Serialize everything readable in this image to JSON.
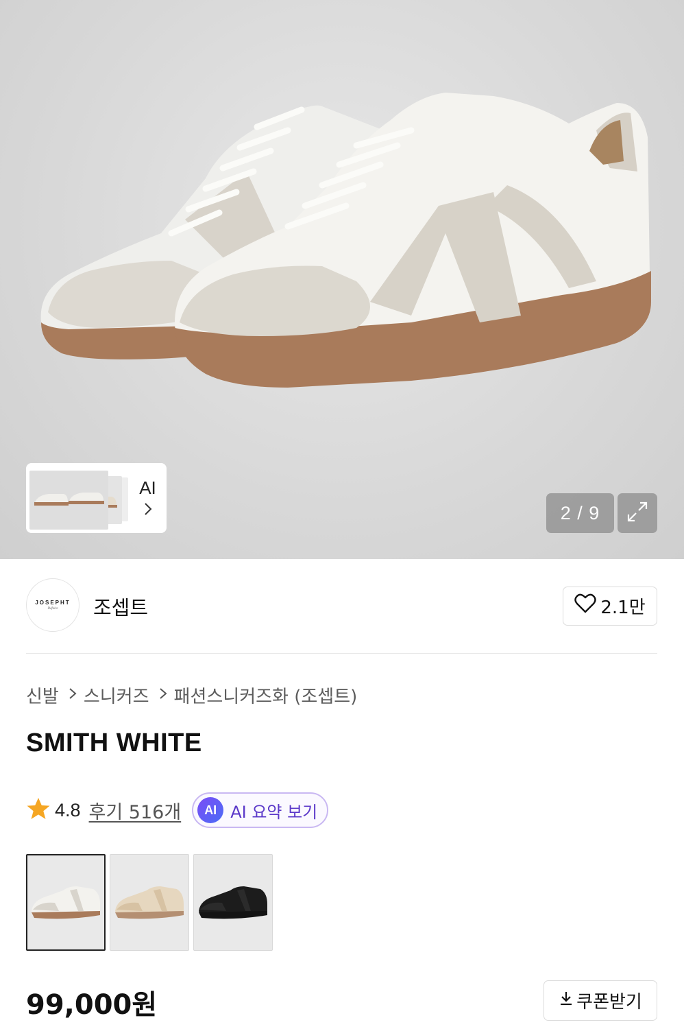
{
  "gallery": {
    "counter": "2 / 9",
    "ai_label": "AI",
    "thumb_icon": "chevron-right-icon",
    "expand_icon": "expand-icon"
  },
  "brand": {
    "logo_text": "JOSEPHT",
    "logo_sub": "Défaire",
    "name": "조셉트",
    "like_count": "2.1만",
    "like_icon": "heart-icon"
  },
  "breadcrumb": [
    "신발",
    "스니커즈",
    "패션스니커즈화 (조셉트)"
  ],
  "product": {
    "title": "SMITH WHITE",
    "rating": "4.8",
    "review_label": "후기 516개",
    "ai_badge": "AI",
    "ai_summary_label": "AI 요약 보기",
    "price": "99,000원",
    "coupon_label": "쿠폰받기"
  },
  "options": [
    {
      "name": "white",
      "upper": "#f3f2ee",
      "suede": "#d8d4cc",
      "sole": "#a97b5b"
    },
    {
      "name": "beige",
      "upper": "#e6d7bf",
      "suede": "#d7c2a3",
      "sole": "#b48f72"
    },
    {
      "name": "black",
      "upper": "#1c1c1c",
      "suede": "#2b2b2b",
      "sole": "#141414"
    }
  ],
  "colors": {
    "star": "#f5a623",
    "ai_accent": "#5b38c9",
    "sole": "#a97b5b"
  }
}
